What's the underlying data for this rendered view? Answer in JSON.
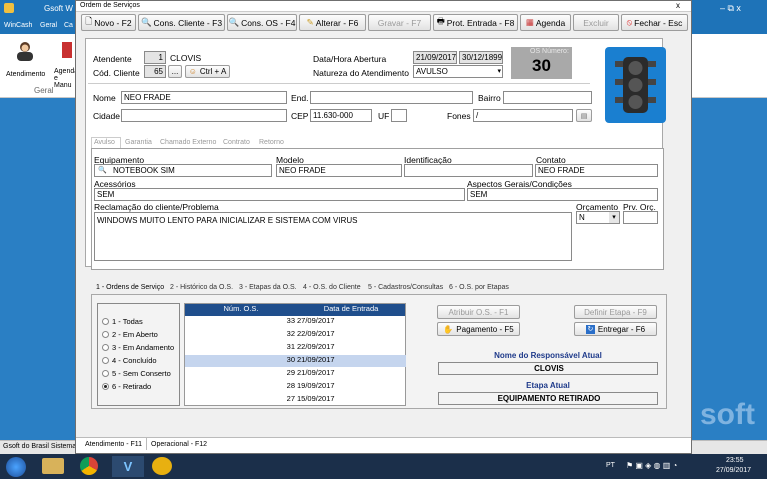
{
  "background": {
    "title": "Gsoft W",
    "menu": [
      "WinCash",
      "Geral",
      "Ca"
    ],
    "ribbon_items": [
      "Atendimento",
      "Agenda e Manu"
    ],
    "ribbon_group": "Geral",
    "status_left": "Gsoft do Brasil Sistemas",
    "watermark": "soft",
    "window_controls": "– ⧉ x"
  },
  "window": {
    "title": "Ordem de Serviços",
    "close_label": "x"
  },
  "toolbar": {
    "novo": "Novo - F2",
    "cons_cliente": "Cons. Cliente - F3",
    "cons_os": "Cons. OS - F4",
    "alterar": "Alterar - F6",
    "gravar": "Gravar - F7",
    "prot_entrada": "Prot. Entrada - F8",
    "agenda": "Agenda",
    "excluir": "Excluir",
    "fechar": "Fechar - Esc"
  },
  "header": {
    "atendente_label": "Atendente",
    "atendente_code": "1",
    "atendente_name": "CLOVIS",
    "cod_cliente_label": "Cód. Cliente",
    "cod_cliente": "65",
    "ellipsis": "...",
    "ctrl_a": "Ctrl + A",
    "data_hora_label": "Data/Hora Abertura",
    "data_abertura": "21/09/2017",
    "hora_abertura": "30/12/1899",
    "natureza_label": "Natureza do Atendimento",
    "natureza_value": "AVULSO",
    "os_numero_label": "OS Número:",
    "os_numero": "30"
  },
  "client": {
    "nome_label": "Nome",
    "nome": "NEO FRADE",
    "end_label": "End.",
    "end": "",
    "bairro_label": "Bairro",
    "bairro": "",
    "cidade_label": "Cidade",
    "cidade": "",
    "cep_label": "CEP",
    "cep": "11.630-000",
    "uf_label": "UF",
    "uf": "",
    "fones_label": "Fones",
    "fones": "/"
  },
  "tabs": [
    "Avulso",
    "Garantia",
    "Chamado Externo",
    "Contrato",
    "Retorno"
  ],
  "equipment": {
    "equipamento_label": "Equipamento",
    "equipamento": "NOTEBOOK SIM",
    "modelo_label": "Modelo",
    "modelo": "NEO FRADE",
    "identificacao_label": "Identificação",
    "identificacao": "",
    "contato_label": "Contato",
    "contato": "NEO FRADE",
    "acessorios_label": "Acessórios",
    "acessorios": "SEM",
    "aspectos_label": "Aspectos Gerais/Condições",
    "aspectos": "SEM",
    "reclamacao_label": "Reclamação do cliente/Problema",
    "reclamacao": "WINDOWS MUITO LENTO PARA INICIALIZAR E SISTEMA COM VIRUS",
    "orcamento_label": "Orçamento",
    "orcamento": "N",
    "prv_orc_label": "Prv. Orç.",
    "prv_orc": ""
  },
  "bottom_tabs": [
    "1 - Ordens de Serviço",
    "2 - Histórico da O.S.",
    "3 - Etapas da O.S.",
    "4 - O.S. do Cliente",
    "5 - Cadastros/Consultas",
    "6 - O.S. por Etapas"
  ],
  "filters": [
    "1 - Todas",
    "2 - Em Aberto",
    "3 - Em Andamento",
    "4 - Concluído",
    "5 - Sem Conserto",
    "6 - Retirado"
  ],
  "grid": {
    "columns": [
      "Núm. O.S.",
      "Data de Entrada"
    ],
    "rows": [
      {
        "num": "33",
        "date": "27/09/2017"
      },
      {
        "num": "32",
        "date": "22/09/2017"
      },
      {
        "num": "31",
        "date": "22/09/2017"
      },
      {
        "num": "30",
        "date": "21/09/2017"
      },
      {
        "num": "29",
        "date": "21/09/2017"
      },
      {
        "num": "28",
        "date": "19/09/2017"
      },
      {
        "num": "27",
        "date": "15/09/2017"
      }
    ]
  },
  "actions": {
    "atribuir": "Atribuir O.S. - F1",
    "definir": "Definir Etapa - F9",
    "pagamento": "Pagamento - F5",
    "entregar": "Entregar - F6",
    "responsavel_label": "Nome do Responsável Atual",
    "responsavel": "CLOVIS",
    "etapa_label": "Etapa Atual",
    "etapa": "EQUIPAMENTO RETIRADO"
  },
  "footer_tabs": [
    "Atendimento - F11",
    "Operacional - F12"
  ],
  "tray": {
    "lang": "PT",
    "time": "23:55",
    "date": "27/09/2017"
  },
  "colors": {
    "desktop_blue": "#1e73b8",
    "grid_header": "#1f4e8c",
    "grid_selected": "#c5d5ee",
    "os_box": "#a9a9a9",
    "traffic_light_bg": "#1a7fd0",
    "accent_text": "#1e3a8a"
  }
}
